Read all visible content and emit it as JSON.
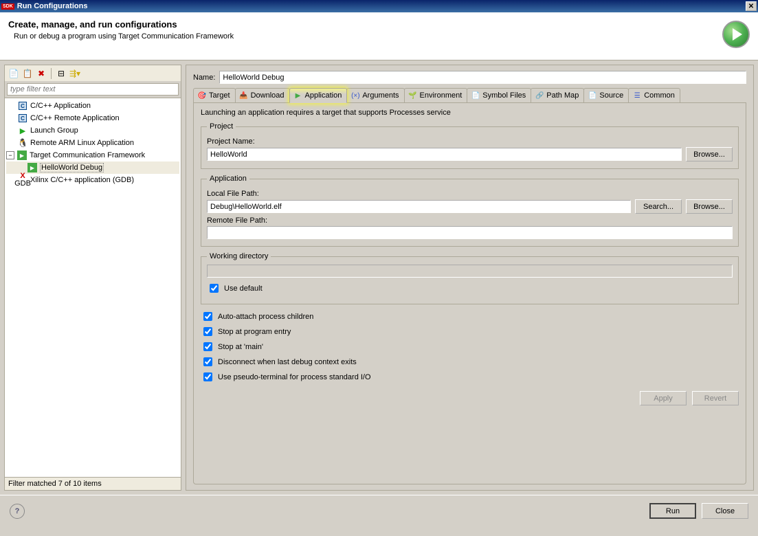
{
  "window": {
    "title": "Run Configurations",
    "badge": "SDK"
  },
  "header": {
    "title": "Create, manage, and run configurations",
    "subtitle": "Run or debug a program using Target Communication Framework"
  },
  "filter": {
    "placeholder": "type filter text",
    "status": "Filter matched 7 of 10 items"
  },
  "tree": [
    {
      "label": "C/C++ Application",
      "icon": "c"
    },
    {
      "label": "C/C++ Remote Application",
      "icon": "c"
    },
    {
      "label": "Launch Group",
      "icon": "play"
    },
    {
      "label": "Remote ARM Linux Application",
      "icon": "penguin"
    },
    {
      "label": "Target Communication Framework",
      "icon": "green",
      "expanded": true,
      "children": [
        {
          "label": "HelloWorld Debug",
          "icon": "green",
          "selected": true
        }
      ]
    },
    {
      "label": "Xilinx C/C++ application (GDB)",
      "icon": "xilinx"
    }
  ],
  "form": {
    "name_label": "Name:",
    "name_value": "HelloWorld Debug",
    "tabs": [
      "Target",
      "Download",
      "Application",
      "Arguments",
      "Environment",
      "Symbol Files",
      "Path Map",
      "Source",
      "Common"
    ],
    "active_tab": 2,
    "info": "Launching an application requires a target that supports Processes service",
    "project": {
      "legend": "Project",
      "name_label": "Project Name:",
      "name_value": "HelloWorld",
      "browse": "Browse..."
    },
    "application": {
      "legend": "Application",
      "local_label": "Local File Path:",
      "local_value": "Debug\\HelloWorld.elf",
      "search": "Search...",
      "browse": "Browse...",
      "remote_label": "Remote File Path:",
      "remote_value": ""
    },
    "workdir": {
      "legend": "Working directory",
      "value": "",
      "use_default": "Use default",
      "use_default_checked": true
    },
    "checks": [
      {
        "label": "Auto-attach process children",
        "checked": true
      },
      {
        "label": "Stop at program entry",
        "checked": true
      },
      {
        "label": "Stop at 'main'",
        "checked": true
      },
      {
        "label": "Disconnect when last debug context exits",
        "checked": true
      },
      {
        "label": "Use pseudo-terminal for process standard I/O",
        "checked": true
      }
    ],
    "apply": "Apply",
    "revert": "Revert"
  },
  "footer": {
    "run": "Run",
    "close": "Close"
  }
}
